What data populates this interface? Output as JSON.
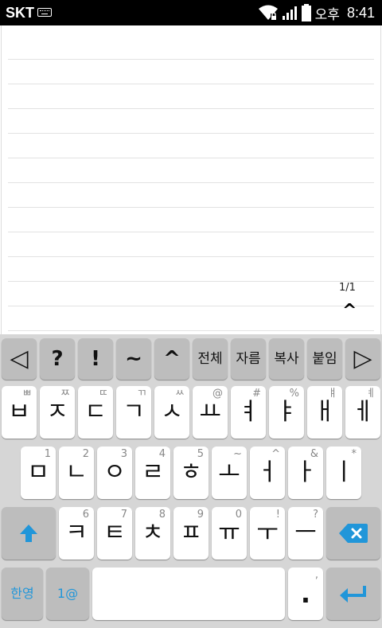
{
  "status_bar": {
    "carrier": "SKT",
    "time_prefix": "오후",
    "time": "8:41"
  },
  "note": {
    "page_indicator": "1/1",
    "scroll_up_label": "^"
  },
  "keyboard": {
    "toolbar": [
      {
        "name": "arrow-left-icon",
        "main": "◁"
      },
      {
        "name": "question-key",
        "main": "?"
      },
      {
        "name": "exclamation-key",
        "main": "!"
      },
      {
        "name": "tilde-key",
        "main": "~"
      },
      {
        "name": "caret-key",
        "main": "^"
      },
      {
        "name": "select-all-key",
        "main": "전체"
      },
      {
        "name": "cut-key",
        "main": "자름"
      },
      {
        "name": "copy-key",
        "main": "복사"
      },
      {
        "name": "paste-key",
        "main": "붙임"
      },
      {
        "name": "arrow-right-icon",
        "main": "▷"
      }
    ],
    "row1": [
      {
        "main": "ㅂ",
        "sub": "ㅃ"
      },
      {
        "main": "ㅈ",
        "sub": "ㅉ"
      },
      {
        "main": "ㄷ",
        "sub": "ㄸ"
      },
      {
        "main": "ㄱ",
        "sub": "ㄲ"
      },
      {
        "main": "ㅅ",
        "sub": "ㅆ"
      },
      {
        "main": "ㅛ",
        "sub": "@"
      },
      {
        "main": "ㅕ",
        "sub": "#"
      },
      {
        "main": "ㅑ",
        "sub": "%"
      },
      {
        "main": "ㅐ",
        "sub": "ㅒ"
      },
      {
        "main": "ㅔ",
        "sub": "ㅖ"
      }
    ],
    "row2": [
      {
        "main": "ㅁ",
        "sub": "1"
      },
      {
        "main": "ㄴ",
        "sub": "2"
      },
      {
        "main": "ㅇ",
        "sub": "3"
      },
      {
        "main": "ㄹ",
        "sub": "4"
      },
      {
        "main": "ㅎ",
        "sub": "5"
      },
      {
        "main": "ㅗ",
        "sub": "~"
      },
      {
        "main": "ㅓ",
        "sub": "^"
      },
      {
        "main": "ㅏ",
        "sub": "&"
      },
      {
        "main": "ㅣ",
        "sub": "*"
      }
    ],
    "row3": [
      {
        "main": "ㅋ",
        "sub": "6"
      },
      {
        "main": "ㅌ",
        "sub": "7"
      },
      {
        "main": "ㅊ",
        "sub": "8"
      },
      {
        "main": "ㅍ",
        "sub": "9"
      },
      {
        "main": "ㅠ",
        "sub": "0"
      },
      {
        "main": "ㅜ",
        "sub": "!"
      },
      {
        "main": "ㅡ",
        "sub": "?"
      }
    ],
    "lang_label": "한영",
    "symbols_label": "1@",
    "period_label": ".",
    "period_sub": ",",
    "accent_color": "#2196d9"
  }
}
